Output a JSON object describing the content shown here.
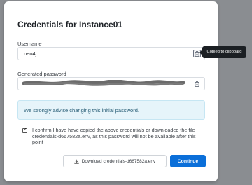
{
  "dialog": {
    "title": "Credentials for Instance01",
    "username": {
      "label": "Username",
      "value": "neo4j"
    },
    "password": {
      "label": "Generated password",
      "masked": true
    },
    "tooltip": "Copied to clipboard",
    "info_text": "We strongly advise changing this initial password.",
    "confirm": {
      "checked": true,
      "check_glyph": "✓",
      "text": "I confirm I have have copied the above credentials or downloaded the file credentials-d667582a.env, as this password will not be available after this point"
    },
    "download_label": "Download credentials-d667582a.env",
    "continue_label": "Continue"
  },
  "icons": {
    "copy": "clipboard-icon",
    "download": "download-icon"
  },
  "colors": {
    "primary": "#0b6fd9",
    "info_bg": "#e6f4fa",
    "tooltip_bg": "#1b1f23",
    "overlay": "#8a8d91"
  }
}
